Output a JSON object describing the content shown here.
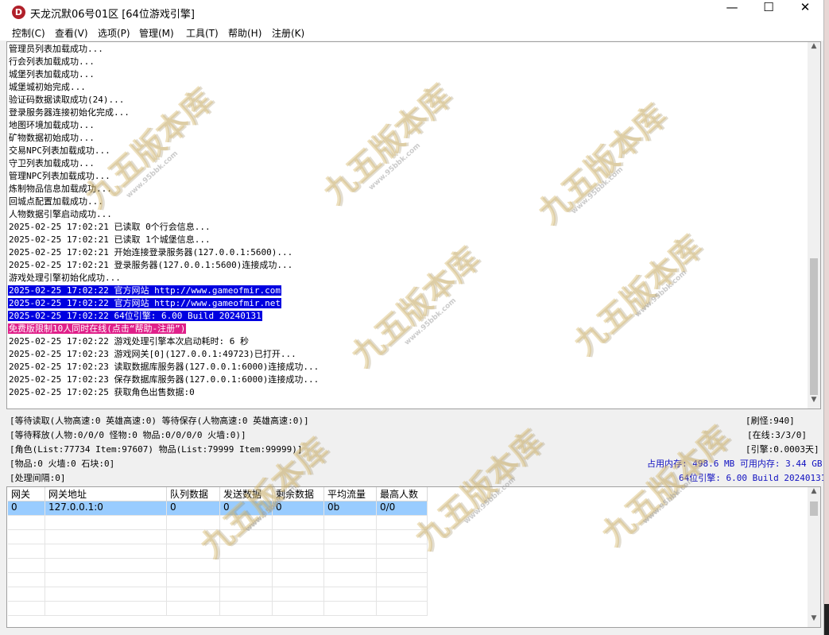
{
  "window": {
    "title": "天龙沉默06号01区 [64位游戏引擎]",
    "icon_letter": "D",
    "minimize_glyph": "—",
    "maximize_glyph": "☐",
    "close_glyph": "✕"
  },
  "menu": [
    "控制(C)",
    "查看(V)",
    "选项(P)",
    "管理(M)",
    "工具(T)",
    "帮助(H)",
    "注册(K)"
  ],
  "log": [
    {
      "text": "管理员列表加载成功...",
      "style": ""
    },
    {
      "text": "行会列表加载成功...",
      "style": ""
    },
    {
      "text": "城堡列表加载成功...",
      "style": ""
    },
    {
      "text": "城堡城初始完成...",
      "style": ""
    },
    {
      "text": "验证码数据读取成功(24)...",
      "style": ""
    },
    {
      "text": "登录服务器连接初始化完成...",
      "style": ""
    },
    {
      "text": "地图环境加载成功...",
      "style": ""
    },
    {
      "text": "矿物数据初始成功...",
      "style": ""
    },
    {
      "text": "交易NPC列表加载成功...",
      "style": ""
    },
    {
      "text": "守卫列表加载成功...",
      "style": ""
    },
    {
      "text": "管理NPC列表加载成功...",
      "style": ""
    },
    {
      "text": "炼制物品信息加载成功...",
      "style": ""
    },
    {
      "text": "回城点配置加载成功...",
      "style": ""
    },
    {
      "text": "人物数据引擎启动成功...",
      "style": ""
    },
    {
      "text": "2025-02-25 17:02:21 已读取 0个行会信息...",
      "style": ""
    },
    {
      "text": "2025-02-25 17:02:21 已读取 1个城堡信息...",
      "style": ""
    },
    {
      "text": "2025-02-25 17:02:21 开始连接登录服务器(127.0.0.1:5600)...",
      "style": ""
    },
    {
      "text": "2025-02-25 17:02:21 登录服务器(127.0.0.1:5600)连接成功...",
      "style": ""
    },
    {
      "text": "游戏处理引擎初始化成功...",
      "style": ""
    },
    {
      "text": "2025-02-25 17:02:22 官方网站 http://www.gameofmir.com",
      "style": "blue"
    },
    {
      "text": "2025-02-25 17:02:22 官方网站 http://www.gameofmir.net",
      "style": "blue"
    },
    {
      "text": "2025-02-25 17:02:22 64位引擎: 6.00 Build 20240131",
      "style": "blue"
    },
    {
      "text": "免费版限制10人同时在线(点击“帮助-注册”)",
      "style": "pink"
    },
    {
      "text": "2025-02-25 17:02:22 游戏处理引擎本次启动耗时: 6 秒",
      "style": ""
    },
    {
      "text": "2025-02-25 17:02:23 游戏网关[0](127.0.0.1:49723)已打开...",
      "style": ""
    },
    {
      "text": "2025-02-25 17:02:23 读取数据库服务器(127.0.0.1:6000)连接成功...",
      "style": ""
    },
    {
      "text": "2025-02-25 17:02:23 保存数据库服务器(127.0.0.1:6000)连接成功...",
      "style": ""
    },
    {
      "text": "2025-02-25 17:02:25 获取角色出售数据:0",
      "style": ""
    }
  ],
  "status": {
    "line1": "[等待读取(人物高速:0 英雄高速:0) 等待保存(人物高速:0 英雄高速:0)]",
    "line2": "[等待释放(人物:0/0/0 怪物:0 物品:0/0/0/0 火墙:0)]",
    "line3": "[角色(List:77734 Item:97607) 物品(List:79999 Item:99999)]",
    "line4": "[物品:0 火墙:0 石块:0]",
    "line5": "[处理间隔:0]",
    "refresh": "[刷怪:940]",
    "online": "[在线:3/3/0]",
    "engine": "[引擎:0.0003天]",
    "memory": "占用内存: 498.6 MB 可用内存: 3.44 GB",
    "build": "64位引擎: 6.00 Build 20240131",
    "accent_blue": "#1010c0"
  },
  "gateway": {
    "columns": [
      "网关",
      "网关地址",
      "队列数据",
      "发送数据",
      "剩余数据",
      "平均流量",
      "最高人数"
    ],
    "rows": [
      [
        "0",
        "127.0.0.1:0",
        "0",
        "0",
        "0",
        "0b",
        "0/0"
      ]
    ],
    "selected_color": "#99ccff"
  },
  "watermark": {
    "text": "九五版本库",
    "url": "www.95bbk.com"
  }
}
